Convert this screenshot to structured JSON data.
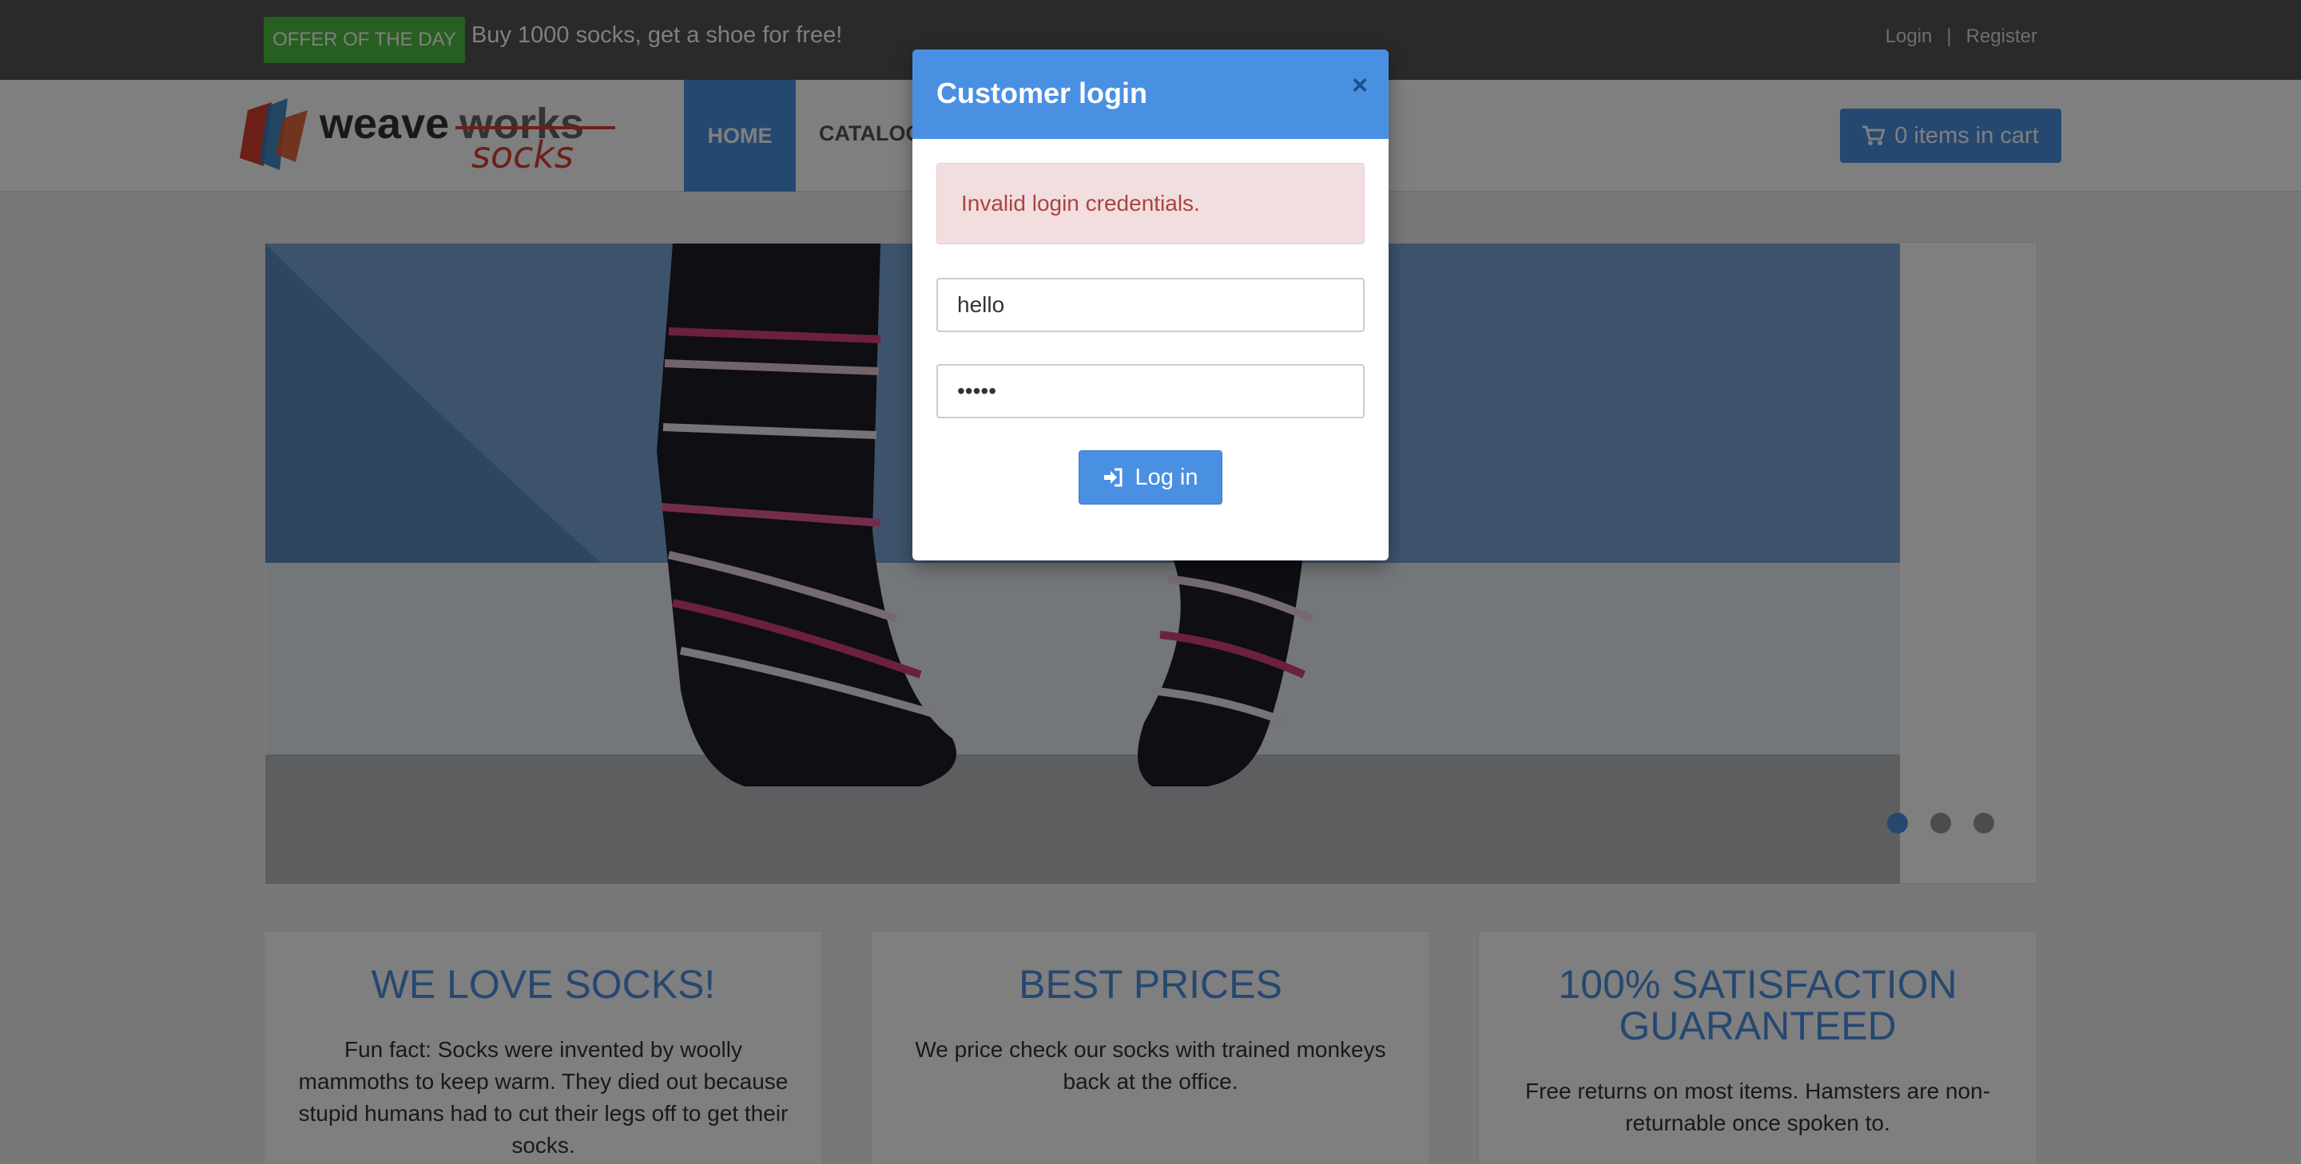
{
  "topbar": {
    "offer_badge": "OFFER OF THE DAY",
    "offer_text": "Buy 1000 socks, get a shoe for free!",
    "login_link": "Login",
    "separator": "|",
    "register_link": "Register"
  },
  "navbar": {
    "logo_word1": "weave",
    "logo_word2": "works",
    "logo_word3": "socks",
    "home": "HOME",
    "catalogue": "CATALOGUE",
    "cart_label": "0 items in cart"
  },
  "carousel": {
    "slide_count": 3,
    "active_slide": 1
  },
  "features": [
    {
      "title": "WE LOVE SOCKS!",
      "text": "Fun fact: Socks were invented by woolly mammoths to keep warm. They died out because stupid humans had to cut their legs off to get their socks."
    },
    {
      "title": "BEST PRICES",
      "text": "We price check our socks with trained monkeys back at the office."
    },
    {
      "title": "100% SATISFACTION GUARANTEED",
      "text": "Free returns on most items. Hamsters are non-returnable once spoken to."
    }
  ],
  "modal": {
    "title": "Customer login",
    "close": "×",
    "error": "Invalid login credentials.",
    "username_value": "hello",
    "password_value": "•••••",
    "login_button": "Log in"
  },
  "colors": {
    "accent": "#4a90e2",
    "offer_green": "#4fbf40",
    "error_bg": "#f2dede",
    "error_text": "#a94442"
  }
}
